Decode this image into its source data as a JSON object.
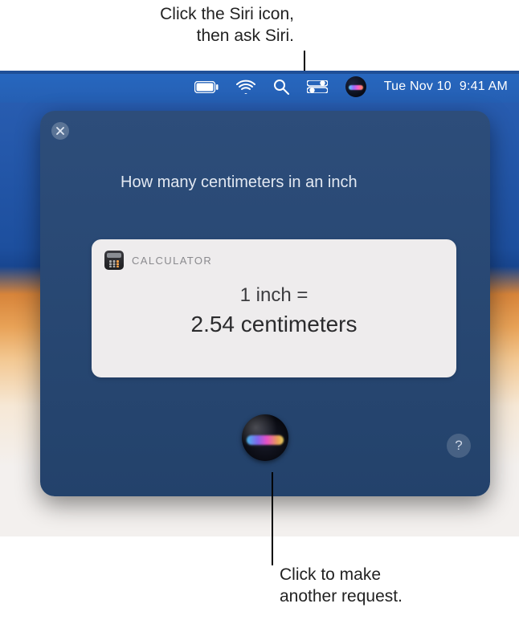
{
  "annotations": {
    "top_line1": "Click the Siri icon,",
    "top_line2": "then ask Siri.",
    "bottom_line1": "Click to make",
    "bottom_line2": "another request."
  },
  "menubar": {
    "date": "Tue Nov 10",
    "time": "9:41 AM"
  },
  "siri": {
    "query": "How many centimeters in an inch",
    "card": {
      "source": "CALCULATOR",
      "line1": "1 inch =",
      "line2": "2.54 centimeters"
    },
    "help_label": "?"
  }
}
